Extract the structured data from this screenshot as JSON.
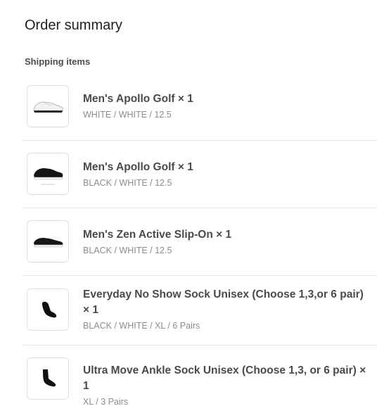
{
  "summary": {
    "title": "Order summary",
    "section_label": "Shipping items",
    "items": [
      {
        "name": "Men's Apollo Golf",
        "qty": "× 1",
        "name_full": "Men's Apollo Golf × 1",
        "variant": "WHITE / WHITE / 12.5",
        "image": "white-golf-shoe"
      },
      {
        "name": "Men's Apollo Golf",
        "qty": "× 1",
        "name_full": "Men's Apollo Golf × 1",
        "variant": "BLACK / WHITE / 12.5",
        "image": "black-golf-shoe"
      },
      {
        "name": "Men's Zen Active Slip-On",
        "qty": "× 1",
        "name_full": "Men's Zen Active Slip-On × 1",
        "variant": "BLACK / WHITE / 12.5",
        "image": "black-slip-on-shoe"
      },
      {
        "name": "Everyday No Show Sock Unisex (Choose 1,3,or 6 pair)",
        "qty": "× 1",
        "name_full": "Everyday No Show Sock Unisex (Choose 1,3,or 6 pair) × 1",
        "variant": "BLACK / WHITE / XL / 6 Pairs",
        "image": "black-no-show-sock"
      },
      {
        "name": "Ultra Move Ankle Sock Unisex (Choose 1,3, or 6 pair)",
        "qty": "× 1",
        "name_full": "Ultra Move Ankle Sock Unisex (Choose 1,3, or 6 pair) × 1",
        "variant": "XL / 3 Pairs",
        "image": "black-ankle-sock"
      }
    ]
  }
}
